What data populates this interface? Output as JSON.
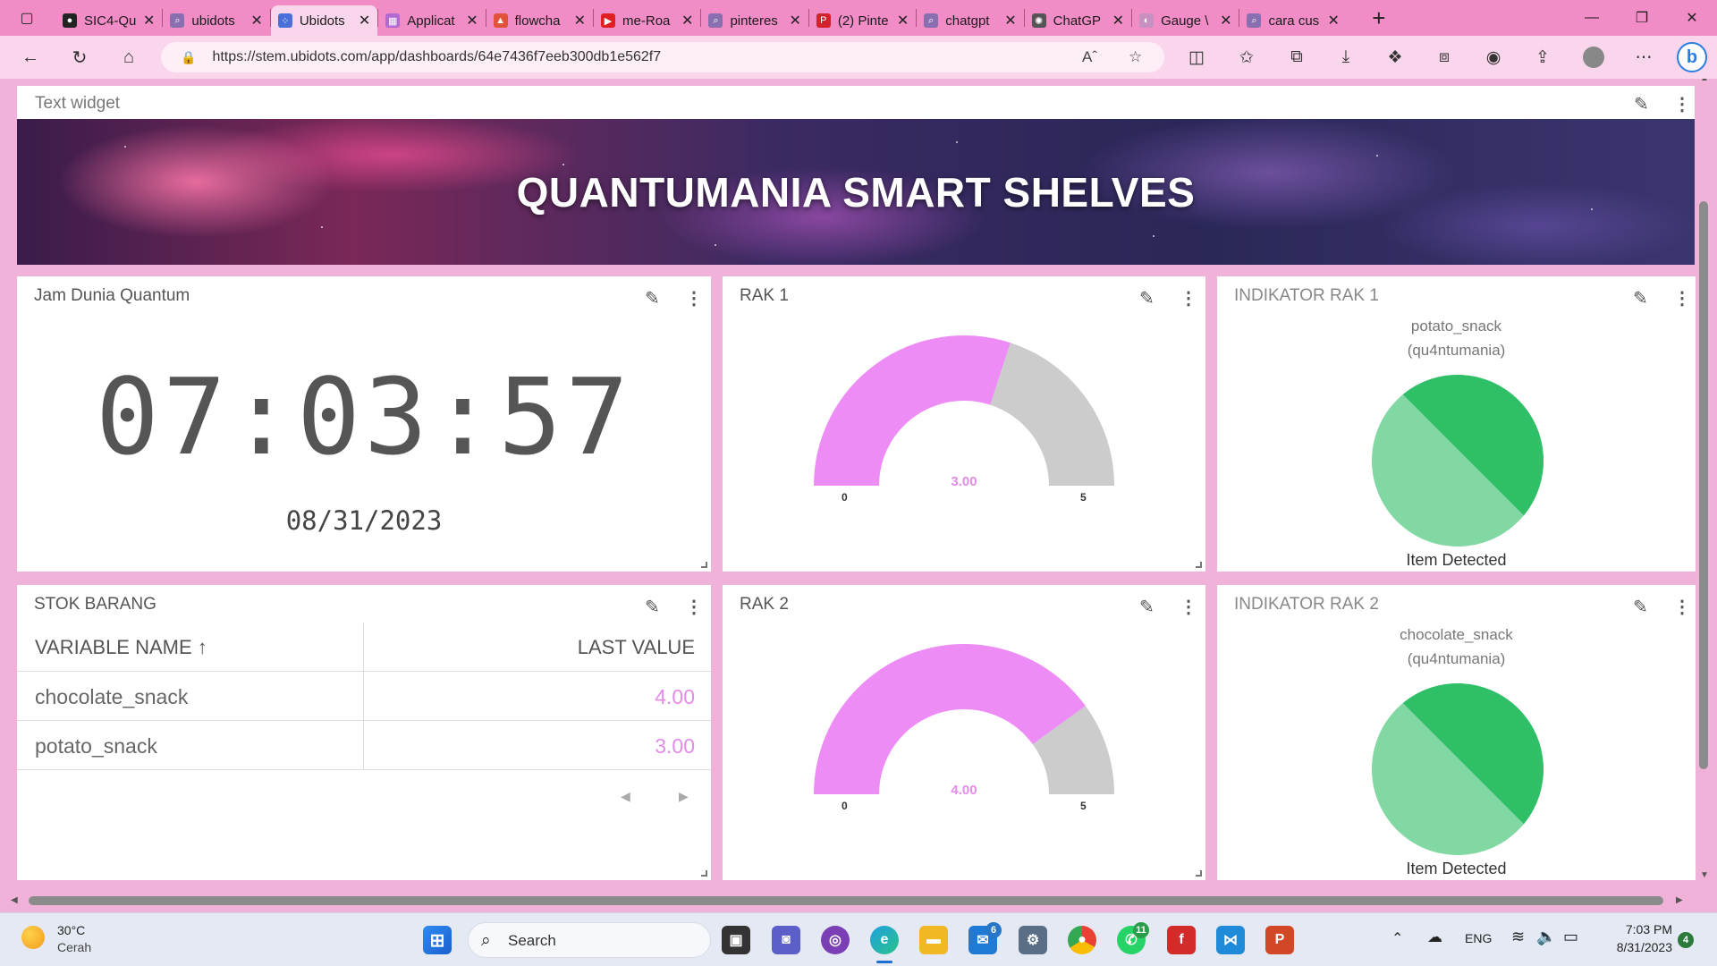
{
  "browser": {
    "tabs": [
      {
        "label": "SIC4-Qu",
        "color": "#222222",
        "glyph": "●",
        "icon": "github-icon"
      },
      {
        "label": "ubidots",
        "color": "#8a6fb0",
        "glyph": "⌕",
        "icon": "search-icon"
      },
      {
        "label": "Ubidots",
        "color": "#4a6fd8",
        "glyph": "⁘",
        "icon": "ubidots-icon",
        "active": true
      },
      {
        "label": "Applicat",
        "color": "#b06ad0",
        "glyph": "▦",
        "icon": "grid-app-icon"
      },
      {
        "label": "flowcha",
        "color": "#e0533a",
        "glyph": "▲",
        "icon": "flowchart-icon"
      },
      {
        "label": "me-Roa",
        "color": "#e02020",
        "glyph": "▶",
        "icon": "youtube-icon"
      },
      {
        "label": "pinteres",
        "color": "#8a6fb0",
        "glyph": "⌕",
        "icon": "search-icon"
      },
      {
        "label": "(2) Pinte",
        "color": "#d3222a",
        "glyph": "P",
        "icon": "pinterest-icon"
      },
      {
        "label": "chatgpt",
        "color": "#8a6fb0",
        "glyph": "⌕",
        "icon": "search-icon"
      },
      {
        "label": "ChatGP",
        "color": "#555555",
        "glyph": "✺",
        "icon": "chatgpt-icon"
      },
      {
        "label": "Gauge \\",
        "color": "#c890c0",
        "glyph": "◐",
        "icon": "gauge-icon"
      },
      {
        "label": "cara cus",
        "color": "#8a6fb0",
        "glyph": "⌕",
        "icon": "search-icon"
      }
    ],
    "new_tab": "+",
    "url": "https://stem.ubidots.com/app/dashboards/64e7436f7eeb300db1e562f7"
  },
  "dashboard": {
    "text_widget_title": "Text widget",
    "banner_title": "QUANTUMANIA SMART SHELVES",
    "clock": {
      "title": "Jam Dunia Quantum",
      "time": "07:03:57",
      "date": "08/31/2023"
    },
    "rak1": {
      "title": "RAK 1",
      "value": "3.00",
      "value_num": 3,
      "min": "0",
      "max": "5",
      "fill_color": "#ee8cf5",
      "empty_color": "#cccccc"
    },
    "rak2": {
      "title": "RAK 2",
      "value": "4.00",
      "value_num": 4,
      "min": "0",
      "max": "5",
      "fill_color": "#ee8cf5",
      "empty_color": "#cccccc"
    },
    "indikator1": {
      "title": "INDIKATOR RAK 1",
      "variable": "potato_snack",
      "device": "(qu4ntumania)",
      "status": "Item Detected",
      "color_dark": "#2fbf66",
      "color_light": "#82d8a3"
    },
    "indikator2": {
      "title": "INDIKATOR RAK 2",
      "variable": "chocolate_snack",
      "device": "(qu4ntumania)",
      "status": "Item Detected",
      "color_dark": "#2fbf66",
      "color_light": "#82d8a3"
    },
    "stok": {
      "title": "STOK BARANG",
      "col_name": "VARIABLE NAME",
      "col_value": "LAST VALUE",
      "sort_arrow": "↑",
      "rows": [
        {
          "name": "chocolate_snack",
          "value": "4.00"
        },
        {
          "name": "potato_snack",
          "value": "3.00"
        }
      ]
    }
  },
  "taskbar": {
    "weather_temp": "30°C",
    "weather_desc": "Cerah",
    "search_label": "Search",
    "mail_badge": "6",
    "whatsapp_badge": "11",
    "language": "ENG",
    "clock_time": "7:03 PM",
    "clock_date": "8/31/2023",
    "notification_count": "4"
  }
}
